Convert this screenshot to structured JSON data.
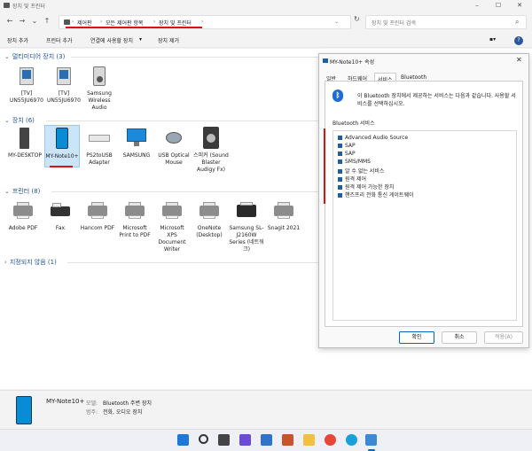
{
  "window": {
    "title": "장치 및 프린터"
  },
  "address": {
    "breadcrumbs": [
      "제어판",
      "모든 제어판 항목",
      "장치 및 프린터"
    ],
    "search_placeholder": "장치 및 프린터 검색"
  },
  "toolbar": {
    "add_device": "장치 추가",
    "add_printer": "프린터 추가",
    "connect_using": "연결에 사용할 장치",
    "remove_device": "장치 제거"
  },
  "groups": {
    "multimedia": {
      "title": "멀티미디어 장치 (3)",
      "items": [
        {
          "label": "[TV] UN55JU6970",
          "icon": "tv-icon"
        },
        {
          "label": "[TV] UN55JU6970",
          "icon": "tv-icon"
        },
        {
          "label": "Samsung Wireless Audio",
          "icon": "speaker-icon"
        }
      ]
    },
    "devices": {
      "title": "장치 (6)",
      "items": [
        {
          "label": "MY-DESKTOP",
          "icon": "pc-tower-icon"
        },
        {
          "label": "MY-Note10+",
          "icon": "phone-icon"
        },
        {
          "label": "PS2toUSB Adapter",
          "icon": "keyboard-icon"
        },
        {
          "label": "SAMSUNG",
          "icon": "monitor-icon"
        },
        {
          "label": "USB Optical Mouse",
          "icon": "mouse-icon"
        },
        {
          "label": "스피커 (Sound Blaster Audigy Fx)",
          "icon": "speaker-icon"
        }
      ]
    },
    "printers": {
      "title": "프린터 (8)",
      "items": [
        {
          "label": "Adobe PDF",
          "icon": "printer-icon"
        },
        {
          "label": "Fax",
          "icon": "fax-icon"
        },
        {
          "label": "Hancom PDF",
          "icon": "printer-icon"
        },
        {
          "label": "Microsoft Print to PDF",
          "icon": "printer-icon"
        },
        {
          "label": "Microsoft XPS Document Writer",
          "icon": "printer-icon"
        },
        {
          "label": "OneNote (Desktop)",
          "icon": "printer-icon"
        },
        {
          "label": "Samsung SL-J2160W Series (네트워크)",
          "icon": "printer-icon"
        },
        {
          "label": "Snagit 2021",
          "icon": "printer-icon"
        }
      ]
    },
    "unspecified": {
      "title": "지정되지 않음 (1)"
    }
  },
  "dialog": {
    "title": "MY-Note10+ 속성",
    "tabs": [
      "일반",
      "하드웨어",
      "서비스",
      "Bluetooth"
    ],
    "active_tab": "서비스",
    "description": "이 Bluetooth 장치에서 제공하는 서비스는 다음과 같습니다. 사용할 서비스를 선택하십시오.",
    "services_label": "Bluetooth 서비스",
    "services": [
      {
        "name": "Advanced Audio Source",
        "checked": true
      },
      {
        "name": "SAP",
        "checked": true
      },
      {
        "name": "SAP",
        "checked": true
      },
      {
        "name": "SMS/MMS",
        "checked": true
      },
      {
        "name": "알 수 없는 서비스",
        "checked": true
      },
      {
        "name": "원격 제어",
        "checked": true
      },
      {
        "name": "원격 제어 가능한 장치",
        "checked": true
      },
      {
        "name": "핸즈프리 전화 통신 게이트웨이",
        "checked": true
      }
    ],
    "ok": "확인",
    "cancel": "취소",
    "apply": "적용(A)"
  },
  "details": {
    "name": "MY-Note10+",
    "model_key": "모델:",
    "model_value": "Bluetooth 주변 장치",
    "category_key": "범주:",
    "category_value": "전화, 오디오 장치"
  },
  "colors": {
    "accent": "#0067c0",
    "highlight_red": "#dd1111",
    "selection": "#cce4f7"
  }
}
